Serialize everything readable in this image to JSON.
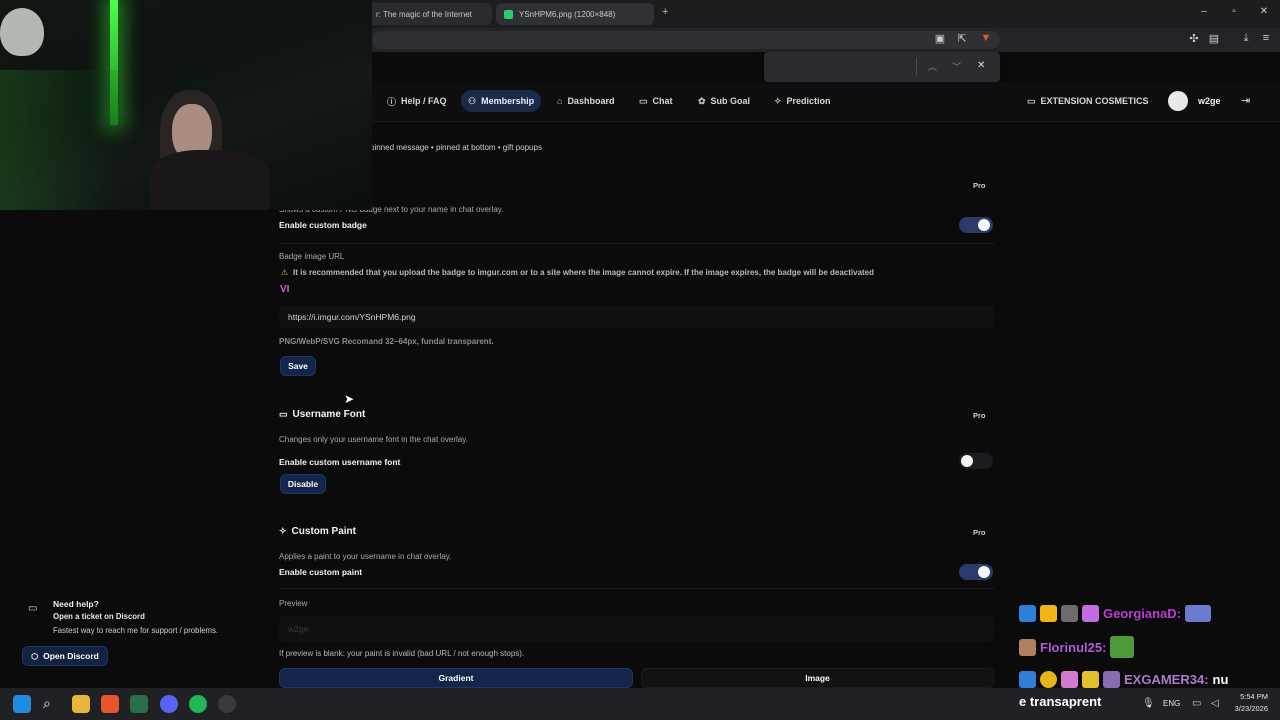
{
  "browser": {
    "tabs": [
      {
        "label": "r: The magic of the Internet"
      },
      {
        "label": "YSnHPM6.png (1200×848)"
      }
    ],
    "new_tab_icon": "plus-icon",
    "window_controls": [
      "minimize-icon",
      "restore-icon",
      "close-icon"
    ]
  },
  "nav": {
    "items": [
      {
        "label": "Help / FAQ",
        "icon": "help-circle-icon"
      },
      {
        "label": "Membership",
        "icon": "user-icon",
        "active": true
      },
      {
        "label": "Dashboard",
        "icon": "home-icon"
      },
      {
        "label": "Chat",
        "icon": "chat-icon"
      },
      {
        "label": "Sub Goal",
        "icon": "gift-icon"
      },
      {
        "label": "Prediction",
        "icon": "sparkle-icon"
      }
    ],
    "extension_cosmetics": "EXTENSION COSMETICS",
    "username": "w2ge"
  },
  "content": {
    "top_note": "pinned message • pinned at bottom • gift popups",
    "badge": {
      "pro": "Pro",
      "description": "Shows a custom PNG badge next to your name in chat overlay.",
      "enable_label": "Enable custom badge",
      "enabled": true,
      "url_label": "Badge image URL",
      "warning": "It is recommended that you upload the badge to imgur.com or to a site where the image cannot expire. If the image expires, the badge will be deactivated",
      "badge_preview": "VI",
      "url_value": "https://i.imgur.com/YSnHPM6.png",
      "hint": "PNG/WebP/SVG Recomand 32–64px, fundal transparent.",
      "save_label": "Save"
    },
    "font": {
      "title": "Username Font",
      "pro": "Pro",
      "description": "Changes only your username font in the chat overlay.",
      "enable_label": "Enable custom username font",
      "enabled": false,
      "disable_label": "Disable"
    },
    "paint": {
      "title": "Custom Paint",
      "pro": "Pro",
      "description": "Applies a paint to your username in chat overlay.",
      "enable_label": "Enable custom paint",
      "enabled": true,
      "preview_label": "Preview",
      "preview_value": "w2ge",
      "note": "If preview is blank: your paint is invalid (bad URL / not enough stops).",
      "tabs": [
        "Gradient",
        "Image"
      ]
    }
  },
  "help": {
    "title": "Need help?",
    "line1": "Open a ticket on Discord",
    "line2": "Fastest way to reach me for support / problems.",
    "button": "Open Discord"
  },
  "chat_overlay": [
    {
      "name": "GeorgianaD:",
      "color": "#c03bd6",
      "text": ""
    },
    {
      "name": "Florinul25:",
      "color": "#b05bd8",
      "text": ""
    },
    {
      "name": "EXGAMER34:",
      "color": "#b07bd0",
      "text": "nu"
    },
    {
      "name": "",
      "color": "#ffffff",
      "text": "e transaprent"
    }
  ],
  "taskbar": {
    "lang": "ENG",
    "time": "5:54 PM",
    "date": "3/23/2026"
  },
  "colors": {
    "accent": "#1c2a4a",
    "toggle_on": "#2a3a6a",
    "button": "#13254a"
  }
}
